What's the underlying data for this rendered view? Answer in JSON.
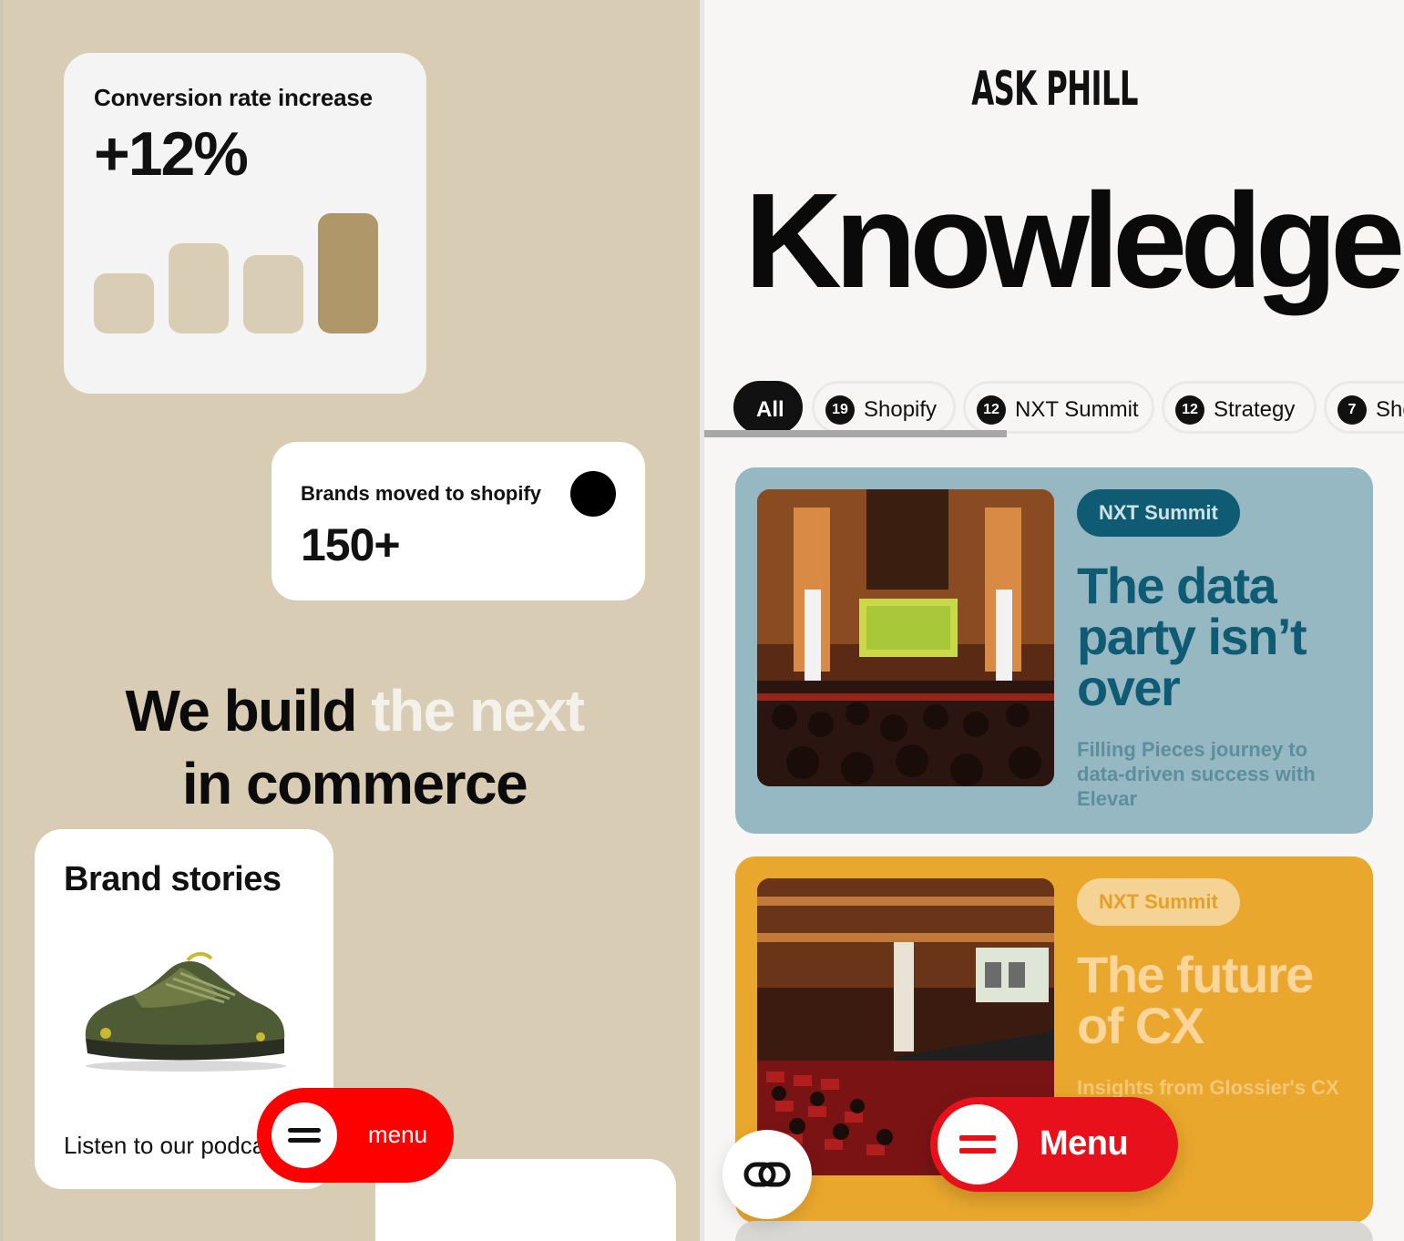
{
  "left": {
    "conversion": {
      "title": "Conversion rate increase",
      "value": "+12%"
    },
    "bars": [
      {
        "level": 0.5,
        "color": "#d9cdb6"
      },
      {
        "level": 0.75,
        "color": "#d9cdb6"
      },
      {
        "level": 0.65,
        "color": "#d9cdb6"
      },
      {
        "level": 1.0,
        "color": "#b0976a"
      }
    ],
    "brands": {
      "title": "Brands moved to shopify",
      "value": "150+"
    },
    "headline": {
      "part1": "We build ",
      "part2": "the next",
      "part3": "in commerce"
    },
    "stories": {
      "title": "Brand stories",
      "subtitle": "Listen to our podcast"
    },
    "menu": {
      "label": "menu",
      "icon": "hamburger-icon"
    }
  },
  "right": {
    "logo": "ASK PHILL",
    "title": "Knowledge",
    "filters": [
      {
        "label": "All",
        "count": null,
        "active": true
      },
      {
        "label": "Shopify",
        "count": "19",
        "active": false
      },
      {
        "label": "NXT Summit",
        "count": "12",
        "active": false
      },
      {
        "label": "Strategy",
        "count": "12",
        "active": false
      },
      {
        "label": "Sho",
        "count": "7",
        "active": false
      }
    ],
    "articles": [
      {
        "tag": "NXT Summit",
        "title": "The data party isn’t over",
        "description": "Filling Pieces journey to data-driven success with Elevar",
        "accent": "#0f5b73",
        "background": "#95b8c3"
      },
      {
        "tag": "NXT Summit",
        "title": "The future of CX",
        "description": "Insights from Glossier's CX",
        "accent": "#fbd59a",
        "background": "#e9a72d"
      }
    ],
    "menu": {
      "label": "Menu",
      "icon": "equals-icon"
    },
    "link_button": {
      "icon": "link-icon"
    }
  }
}
